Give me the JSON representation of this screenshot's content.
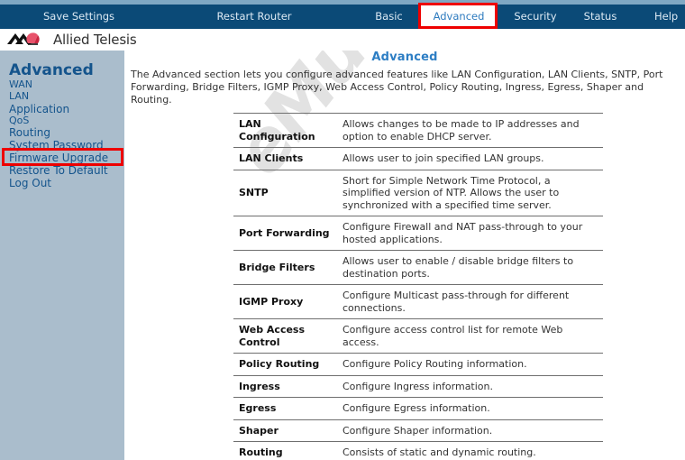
{
  "topnav": {
    "items": [
      {
        "id": "save-settings",
        "label": "Save Settings",
        "active": false
      },
      {
        "id": "restart-router",
        "label": "Restart Router",
        "active": false
      },
      {
        "id": "basic",
        "label": "Basic",
        "active": false
      },
      {
        "id": "advanced",
        "label": "Advanced",
        "active": true
      },
      {
        "id": "security",
        "label": "Security",
        "active": false
      },
      {
        "id": "status",
        "label": "Status",
        "active": false
      },
      {
        "id": "help",
        "label": "Help",
        "active": false
      }
    ],
    "highlight_color": "#ee0000",
    "bar_color": "#0b4a77",
    "active_tab": "Advanced"
  },
  "brand": {
    "name": "Allied Telesis",
    "logo_icon": "allied-telesis-chevron-icon"
  },
  "sidebar": {
    "title": "Advanced",
    "items": [
      {
        "label": "WAN"
      },
      {
        "label": "LAN"
      },
      {
        "label": "Application",
        "selected": true
      },
      {
        "label": "QoS"
      },
      {
        "label": "Routing"
      },
      {
        "label": "System Password"
      },
      {
        "label": "Firmware Upgrade"
      },
      {
        "label": "Restore To Default"
      },
      {
        "label": "Log Out"
      }
    ],
    "selected_item": "Application",
    "background_color": "#aabdcc",
    "link_color": "#14548c"
  },
  "main": {
    "title": "Advanced",
    "intro": "The Advanced section lets you configure advanced features like LAN Configuration, LAN Clients, SNTP, Port Forwarding, Bridge Filters, IGMP Proxy, Web Access Control, Policy Routing, Ingress, Egress, Shaper and Routing.",
    "watermark": "eMule",
    "features": [
      {
        "name": "LAN Configuration",
        "description": "Allows changes to be made to IP addresses and option to enable DHCP server."
      },
      {
        "name": "LAN Clients",
        "description": "Allows user to join specified LAN groups."
      },
      {
        "name": "SNTP",
        "description": "Short for Simple Network Time Protocol, a simplified version of NTP. Allows the user to synchronized with a specified time server."
      },
      {
        "name": "Port Forwarding",
        "description": "Configure Firewall and NAT pass-through to your hosted applications."
      },
      {
        "name": "Bridge Filters",
        "description": "Allows user to enable / disable bridge filters to destination ports."
      },
      {
        "name": "IGMP Proxy",
        "description": "Configure Multicast pass-through for different connections."
      },
      {
        "name": "Web Access Control",
        "description": "Configure access control list for remote Web access."
      },
      {
        "name": "Policy Routing",
        "description": "Configure Policy Routing information."
      },
      {
        "name": "Ingress",
        "description": "Configure Ingress information."
      },
      {
        "name": "Egress",
        "description": "Configure Egress information."
      },
      {
        "name": "Shaper",
        "description": "Configure Shaper information."
      },
      {
        "name": "Routing",
        "description": "Consists of static and dynamic routing."
      }
    ]
  }
}
